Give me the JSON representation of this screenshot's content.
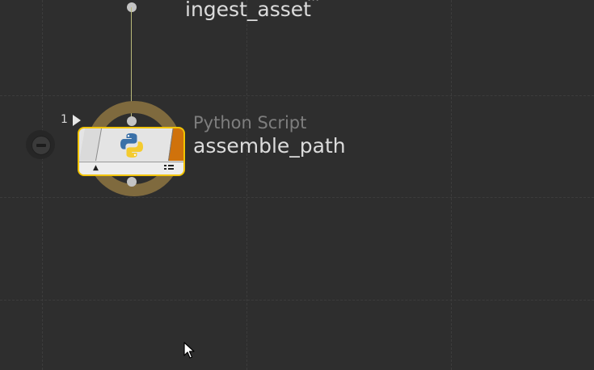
{
  "network_editor": {
    "upstream_node": {
      "type_label_cut": "...",
      "name": "ingest_asset"
    },
    "selected_node": {
      "type_label": "Python Script",
      "name": "assemble_path",
      "output_index": "1",
      "icon": "python-icon",
      "selected": true,
      "display_flag_color": "#d0720b",
      "highlight_color": "#f2c400",
      "selection_ring_color": "#7f6a3e"
    },
    "bypass_button": {
      "icon": "minus-circle-icon"
    }
  },
  "colors": {
    "background": "#2e2e2e",
    "grid": "#3c3c3c",
    "wire": "#b9b97a"
  }
}
